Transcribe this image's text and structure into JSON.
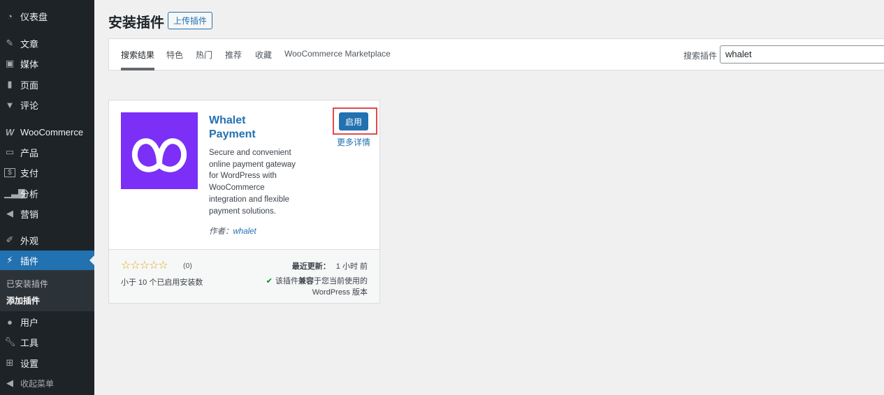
{
  "sidebar": {
    "items": [
      {
        "label": "仪表盘",
        "icon": "dashboard-icon"
      },
      {
        "label": "文章",
        "icon": "pin-icon"
      },
      {
        "label": "媒体",
        "icon": "media-icon"
      },
      {
        "label": "页面",
        "icon": "page-icon"
      },
      {
        "label": "评论",
        "icon": "comment-icon"
      },
      {
        "label": "WooCommerce",
        "icon": "woocommerce-icon"
      },
      {
        "label": "产品",
        "icon": "archive-icon"
      },
      {
        "label": "支付",
        "icon": "dollar-icon"
      },
      {
        "label": "分析",
        "icon": "chart-icon"
      },
      {
        "label": "营销",
        "icon": "megaphone-icon"
      },
      {
        "label": "外观",
        "icon": "brush-icon"
      },
      {
        "label": "插件",
        "icon": "plugin-icon"
      },
      {
        "label": "用户",
        "icon": "user-icon"
      },
      {
        "label": "工具",
        "icon": "wrench-icon"
      },
      {
        "label": "设置",
        "icon": "settings-icon"
      },
      {
        "label": "收起菜单",
        "icon": "collapse-icon"
      }
    ],
    "submenu": [
      "已安装插件",
      "添加插件"
    ]
  },
  "header": {
    "title": "安装插件",
    "upload": "上传插件"
  },
  "tabs": [
    "搜索结果",
    "特色",
    "热门",
    "推荐",
    "收藏",
    "WooCommerce Marketplace"
  ],
  "search": {
    "label": "搜索插件",
    "value": "whalet"
  },
  "plugin": {
    "title": "Whalet Payment",
    "description": "Secure and convenient online payment gateway for WordPress with WooCommerce integration and flexible payment solutions.",
    "author_label": "作者：",
    "author": "whalet",
    "activate": "启用",
    "more": "更多详情",
    "rating_count": "(0)",
    "installs": "小于 10 个已启用安装数",
    "updated_label": "最近更新：",
    "updated": "1 小时 前",
    "compat_pre": "该插件",
    "compat_bold": "兼容",
    "compat_post": "于您当前使用的 WordPress 版本",
    "rating": 0
  }
}
